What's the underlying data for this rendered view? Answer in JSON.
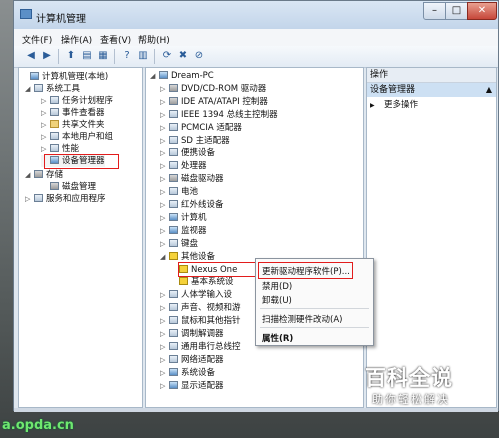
{
  "window": {
    "title": "计算机管理"
  },
  "menu": [
    "文件(F)",
    "操作(A)",
    "查看(V)",
    "帮助(H)"
  ],
  "toolbar_icons": [
    "back-icon",
    "forward-icon",
    "up-icon",
    "show-hide-tree-icon",
    "properties-icon",
    "help-icon",
    "action-pane-icon",
    "update-driver-icon",
    "uninstall-icon",
    "disable-icon"
  ],
  "left_tree": [
    {
      "label": "计算机管理(本地)",
      "indent": 0,
      "icon": "pc",
      "twisty": ""
    },
    {
      "label": "系统工具",
      "indent": 1,
      "icon": "tools",
      "twisty": "◢"
    },
    {
      "label": "任务计划程序",
      "indent": 2,
      "icon": "clock",
      "twisty": "▷"
    },
    {
      "label": "事件查看器",
      "indent": 2,
      "icon": "log",
      "twisty": "▷"
    },
    {
      "label": "共享文件夹",
      "indent": 2,
      "icon": "folder",
      "twisty": "▷"
    },
    {
      "label": "本地用户和组",
      "indent": 2,
      "icon": "users",
      "twisty": "▷"
    },
    {
      "label": "性能",
      "indent": 2,
      "icon": "perf",
      "twisty": "▷"
    },
    {
      "label": "设备管理器",
      "indent": 2,
      "icon": "devmgr",
      "twisty": ""
    },
    {
      "label": "存储",
      "indent": 1,
      "icon": "storage",
      "twisty": "◢"
    },
    {
      "label": "磁盘管理",
      "indent": 2,
      "icon": "disk",
      "twisty": ""
    },
    {
      "label": "服务和应用程序",
      "indent": 1,
      "icon": "services",
      "twisty": "▷"
    }
  ],
  "device_tree": [
    {
      "label": "Dream-PC",
      "indent": 0,
      "icon": "pc",
      "twisty": "◢"
    },
    {
      "label": "DVD/CD-ROM 驱动器",
      "indent": 1,
      "icon": "drive",
      "twisty": "▷"
    },
    {
      "label": "IDE ATA/ATAPI 控制器",
      "indent": 1,
      "icon": "drive",
      "twisty": "▷"
    },
    {
      "label": "IEEE 1394 总线主控制器",
      "indent": 1,
      "icon": "generic",
      "twisty": "▷"
    },
    {
      "label": "PCMCIA 适配器",
      "indent": 1,
      "icon": "generic",
      "twisty": "▷"
    },
    {
      "label": "SD 主适配器",
      "indent": 1,
      "icon": "generic",
      "twisty": "▷"
    },
    {
      "label": "便携设备",
      "indent": 1,
      "icon": "generic",
      "twisty": "▷"
    },
    {
      "label": "处理器",
      "indent": 1,
      "icon": "generic",
      "twisty": "▷"
    },
    {
      "label": "磁盘驱动器",
      "indent": 1,
      "icon": "drive",
      "twisty": "▷"
    },
    {
      "label": "电池",
      "indent": 1,
      "icon": "generic",
      "twisty": "▷"
    },
    {
      "label": "红外线设备",
      "indent": 1,
      "icon": "generic",
      "twisty": "▷"
    },
    {
      "label": "计算机",
      "indent": 1,
      "icon": "pc",
      "twisty": "▷"
    },
    {
      "label": "监视器",
      "indent": 1,
      "icon": "pc",
      "twisty": "▷"
    },
    {
      "label": "键盘",
      "indent": 1,
      "icon": "generic",
      "twisty": "▷"
    },
    {
      "label": "其他设备",
      "indent": 1,
      "icon": "warn",
      "twisty": "◢"
    },
    {
      "label": "Nexus One",
      "indent": 2,
      "icon": "warn",
      "twisty": ""
    },
    {
      "label": "基本系统设",
      "indent": 2,
      "icon": "warn",
      "twisty": ""
    },
    {
      "label": "人体学输入设",
      "indent": 1,
      "icon": "generic",
      "twisty": "▷"
    },
    {
      "label": "声音、视频和游",
      "indent": 1,
      "icon": "generic",
      "twisty": "▷"
    },
    {
      "label": "鼠标和其他指针",
      "indent": 1,
      "icon": "generic",
      "twisty": "▷"
    },
    {
      "label": "调制解调器",
      "indent": 1,
      "icon": "generic",
      "twisty": "▷"
    },
    {
      "label": "通用串行总线控",
      "indent": 1,
      "icon": "generic",
      "twisty": "▷"
    },
    {
      "label": "网络适配器",
      "indent": 1,
      "icon": "generic",
      "twisty": "▷"
    },
    {
      "label": "系统设备",
      "indent": 1,
      "icon": "pc",
      "twisty": "▷"
    },
    {
      "label": "显示适配器",
      "indent": 1,
      "icon": "pc",
      "twisty": "▷"
    }
  ],
  "actions": {
    "header": "操作",
    "section": "设备管理器",
    "caret": "▲",
    "item_arrow": "▶",
    "items": [
      "更多操作"
    ]
  },
  "context_menu": {
    "items": [
      "更新驱动程序软件(P)...",
      "禁用(D)",
      "卸载(U)",
      "扫描检测硬件改动(A)",
      "属性(R)"
    ]
  },
  "watermark": {
    "main": "百科全说",
    "sub": "助你轻松解决",
    "url": "a.opda.cn"
  },
  "colors": {
    "highlight_red": "#e21c1c",
    "selection_blue": "#cde0f3"
  }
}
